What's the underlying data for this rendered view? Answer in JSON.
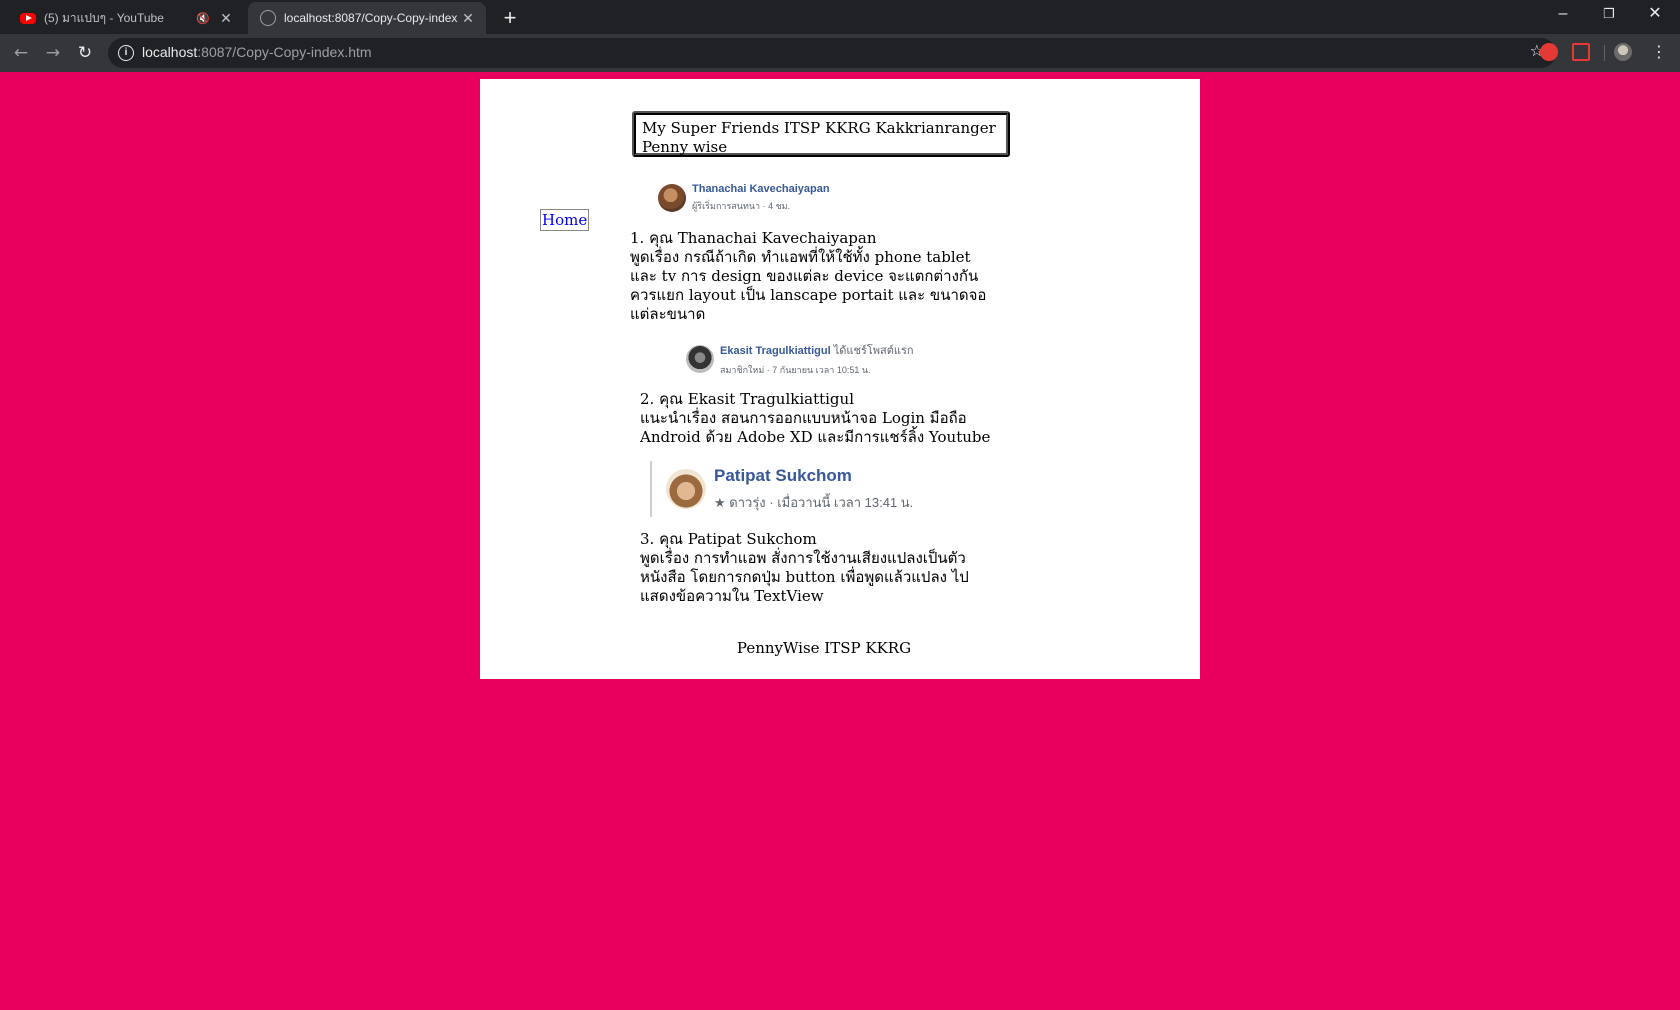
{
  "browser": {
    "tabs": [
      {
        "title": "(5) มาแปบๆ - YouTube",
        "icon": "youtube-icon",
        "muted": true
      },
      {
        "title": "localhost:8087/Copy-Copy-index",
        "icon": "globe-icon",
        "active": true
      }
    ],
    "address": {
      "host": "localhost",
      "path": ":8087/Copy-Copy-index.htm"
    }
  },
  "page": {
    "title": "My Super Friends ITSP KKRG Kakkrianranger Penny wise",
    "home_link": "Home",
    "posts": [
      {
        "author": "Thanachai Kavechaiyapan",
        "meta": "ผู้ริเริ่มการสนทนา · 4 ชม.",
        "lines": [
          "1. คุณ Thanachai Kavechaiyapan",
          " พูดเรื่อง กรณีถ้าเกิด ทำแอพที่ให้ใช้ทั้ง phone tablet",
          "และ tv การ design ของแต่ละ device จะแตกต่างกัน",
          "ควรแยก layout เป็น lanscape portait และ ขนาดจอ",
          "แต่ละขนาด"
        ]
      },
      {
        "author": "Ekasit Tragulkiattigul",
        "author_extra": "ได้แชร์โพสต์แรก",
        "meta": "สมาชิกใหม่ · 7 กันยายน เวลา 10:51 น.",
        "lines": [
          "2. คุณ Ekasit Tragulkiattigul",
          " แนะนำเรื่อง สอนการออกแบบหน้าจอ Login มือถือ",
          "Android ด้วย Adobe XD และมีการแชร์ลิ้ง Youtube"
        ]
      },
      {
        "author": "Patipat Sukchom",
        "meta": "ดาวรุ่ง · เมื่อวานนี้ เวลา 13:41 น.",
        "lines": [
          "3. คุณ Patipat Sukchom",
          "พูดเรื่อง การทำแอพ สั่งการใช้งานเสียงแปลงเป็นตัว",
          "หนังสือ โดยการกดปุ่ม button เพื่อพูดแล้วแปลง ไป",
          "แสดงข้อความใน TextView"
        ]
      }
    ],
    "footer": "PennyWise ITSP KKRG"
  }
}
